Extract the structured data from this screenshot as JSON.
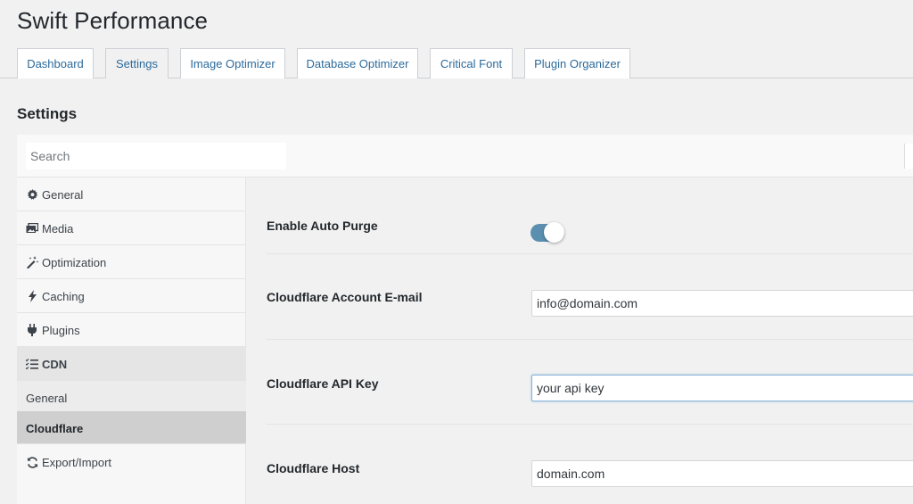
{
  "app": {
    "title": "Swift Performance"
  },
  "tabs": [
    {
      "label": "Dashboard",
      "active": false
    },
    {
      "label": "Settings",
      "active": true
    },
    {
      "label": "Image Optimizer",
      "active": false
    },
    {
      "label": "Database Optimizer",
      "active": false
    },
    {
      "label": "Critical Font",
      "active": false
    },
    {
      "label": "Plugin Organizer",
      "active": false
    }
  ],
  "section": {
    "title": "Settings"
  },
  "search": {
    "placeholder": "Search",
    "value": ""
  },
  "sidebar": {
    "items": [
      {
        "label": "General",
        "icon": "gear-icon"
      },
      {
        "label": "Media",
        "icon": "media-icon"
      },
      {
        "label": "Optimization",
        "icon": "magic-wand-icon"
      },
      {
        "label": "Caching",
        "icon": "lightning-icon"
      },
      {
        "label": "Plugins",
        "icon": "plug-icon"
      },
      {
        "label": "CDN",
        "icon": "list-icon"
      },
      {
        "label": "General"
      },
      {
        "label": "Cloudflare",
        "selected": true
      },
      {
        "label": "Export/Import",
        "icon": "refresh-icon"
      }
    ]
  },
  "fields": {
    "auto_purge": {
      "label": "Enable Auto Purge",
      "enabled": true
    },
    "email": {
      "label": "Cloudflare Account E-mail",
      "value": "info@domain.com"
    },
    "api_key": {
      "label": "Cloudflare API Key",
      "value": "your api key"
    },
    "host": {
      "label": "Cloudflare Host",
      "value": "domain.com"
    }
  },
  "colors": {
    "accent": "#2c6a9b",
    "toggle_on": "#5b8fb0",
    "selected_bg": "#cfcfcf"
  }
}
